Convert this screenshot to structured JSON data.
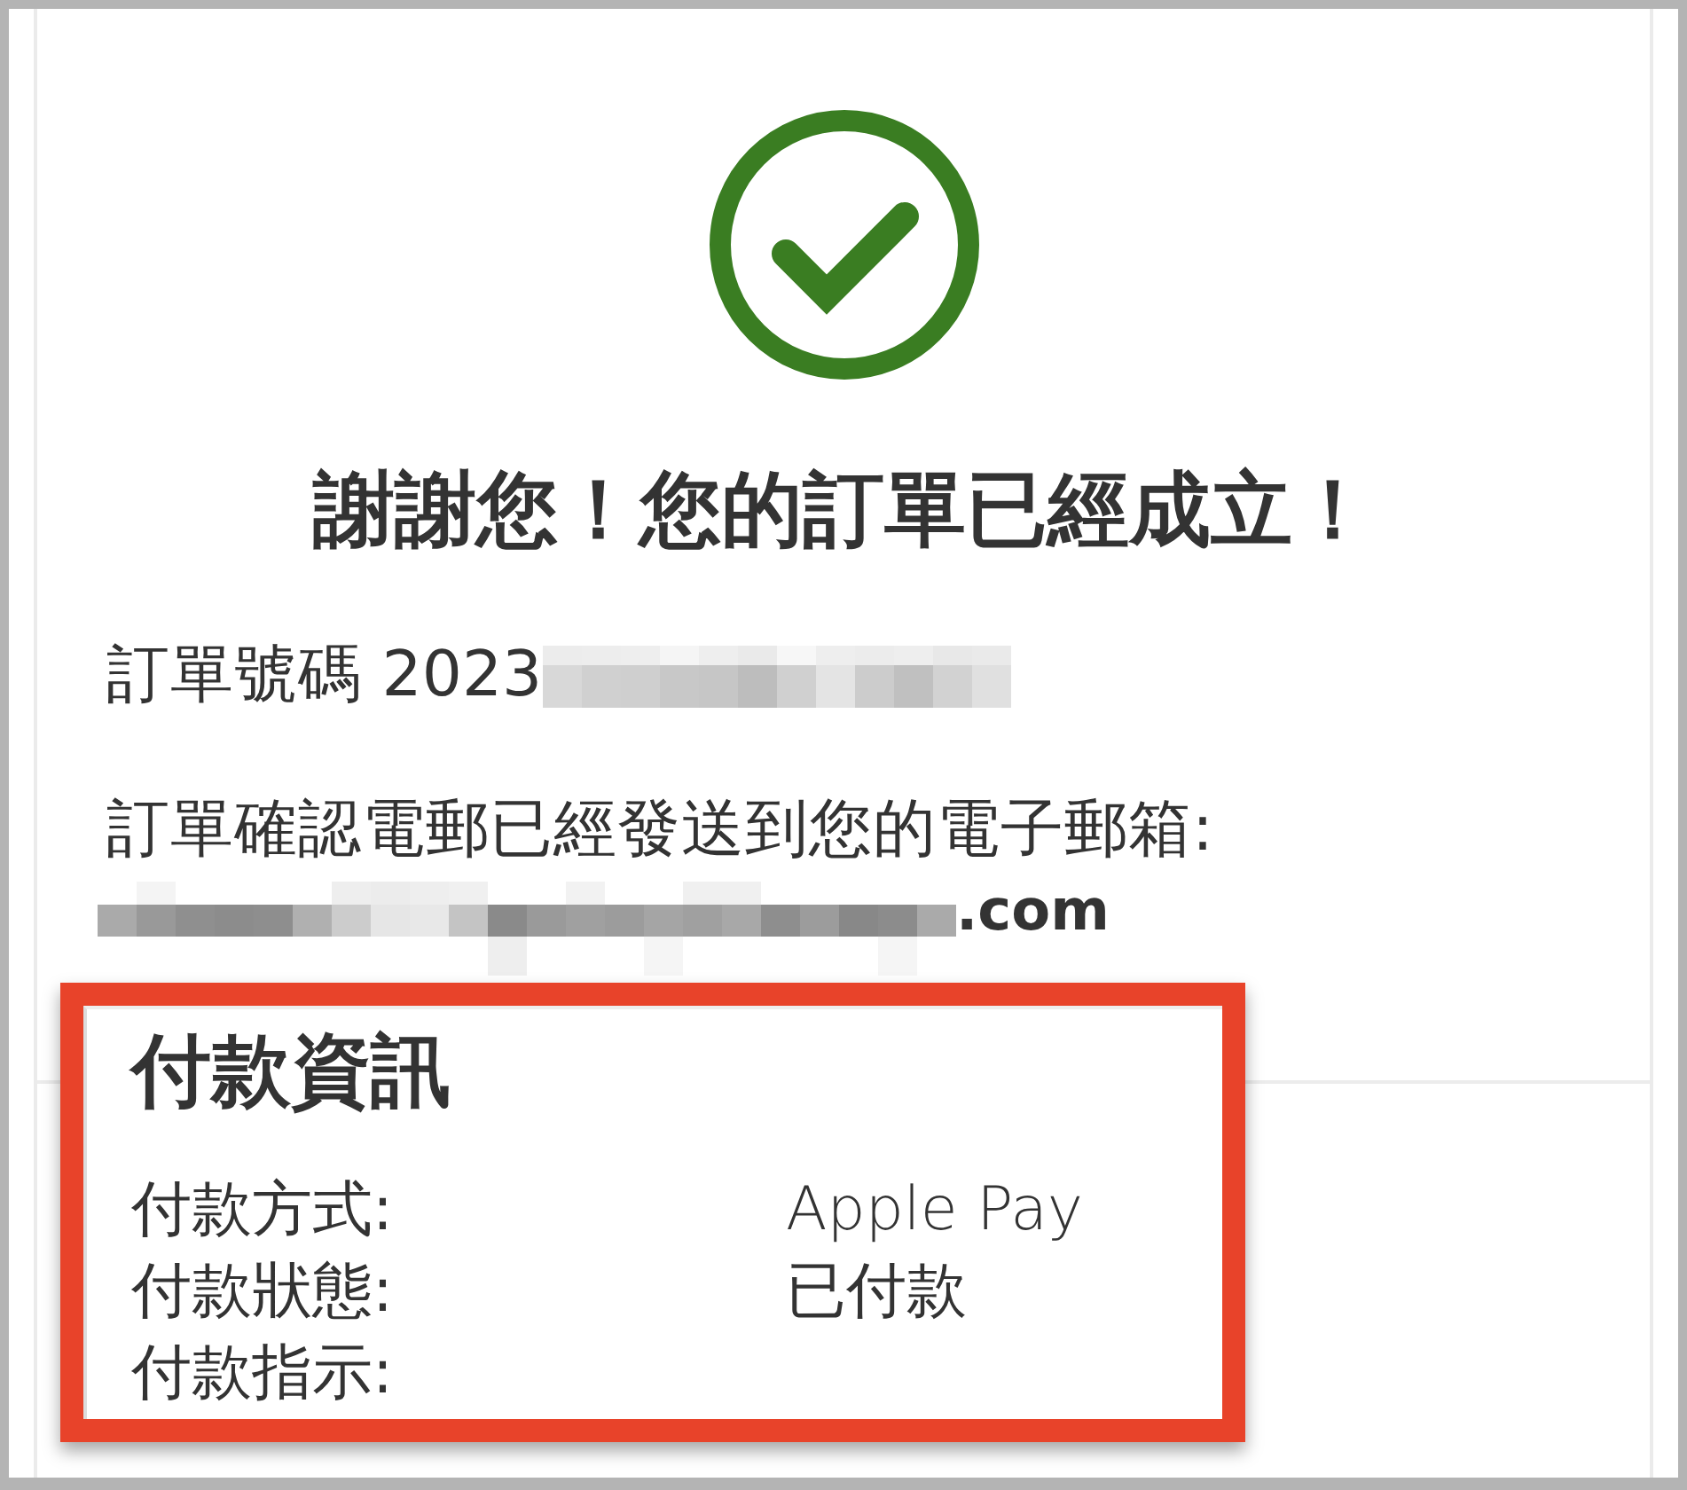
{
  "confirmation": {
    "title": "謝謝您！您的訂單已經成立！",
    "order_number": "訂單號碼 2023",
    "email_notice": "訂單確認電郵已經發送到您的電子郵箱:",
    "email_domain": ".com"
  },
  "payment_info": {
    "title": "付款資訊",
    "rows": [
      {
        "label": "付款方式:",
        "value": "Apple Pay"
      },
      {
        "label": "付款狀態:",
        "value": "已付款"
      },
      {
        "label": "付款指示:"
      }
    ]
  }
}
